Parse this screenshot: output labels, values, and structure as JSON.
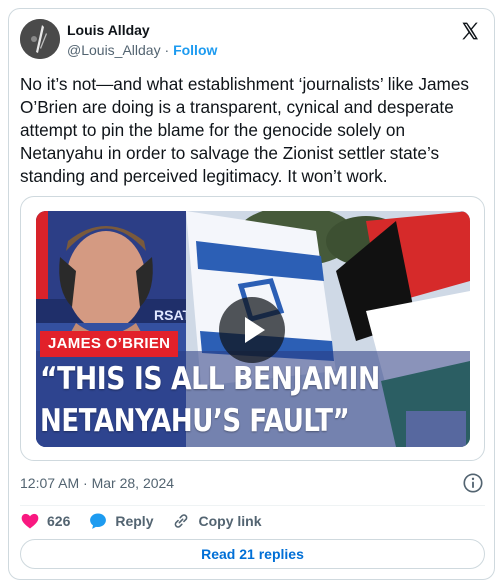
{
  "author": {
    "name": "Louis Allday",
    "handle": "@Louis_Allday",
    "separator": "·",
    "follow_label": "Follow"
  },
  "tweet": {
    "text": "No it’s not—and what establishment ‘journalists’ like James O’Brien are doing is a transparent, cynical and desperate attempt to pin the blame for the genocide solely on Netanyahu in order to salvage the Zionist settler state’s standing and perceived legitimacy. It won’t work."
  },
  "media": {
    "name_strap": "JAMES O’BRIEN",
    "quote_line_1": "“THIS IS ALL BENJAMIN",
    "quote_line_2": "NETANYAHU’S FAULT”",
    "background_text": "RSATIO",
    "strap_color": "#e2212a"
  },
  "meta": {
    "timestamp": "12:07 AM · Mar 28, 2024"
  },
  "actions": {
    "like_count": "626",
    "reply_label": "Reply",
    "copy_label": "Copy link"
  },
  "replies": {
    "label": "Read 21 replies"
  },
  "colors": {
    "accent": "#1d9bf0",
    "like": "#f91880",
    "link": "#006fd6"
  },
  "icons": {
    "platform": "x-logo-icon",
    "info": "info-icon",
    "like": "heart-icon",
    "reply": "reply-bubble-icon",
    "copy": "link-icon",
    "play": "play-icon"
  }
}
